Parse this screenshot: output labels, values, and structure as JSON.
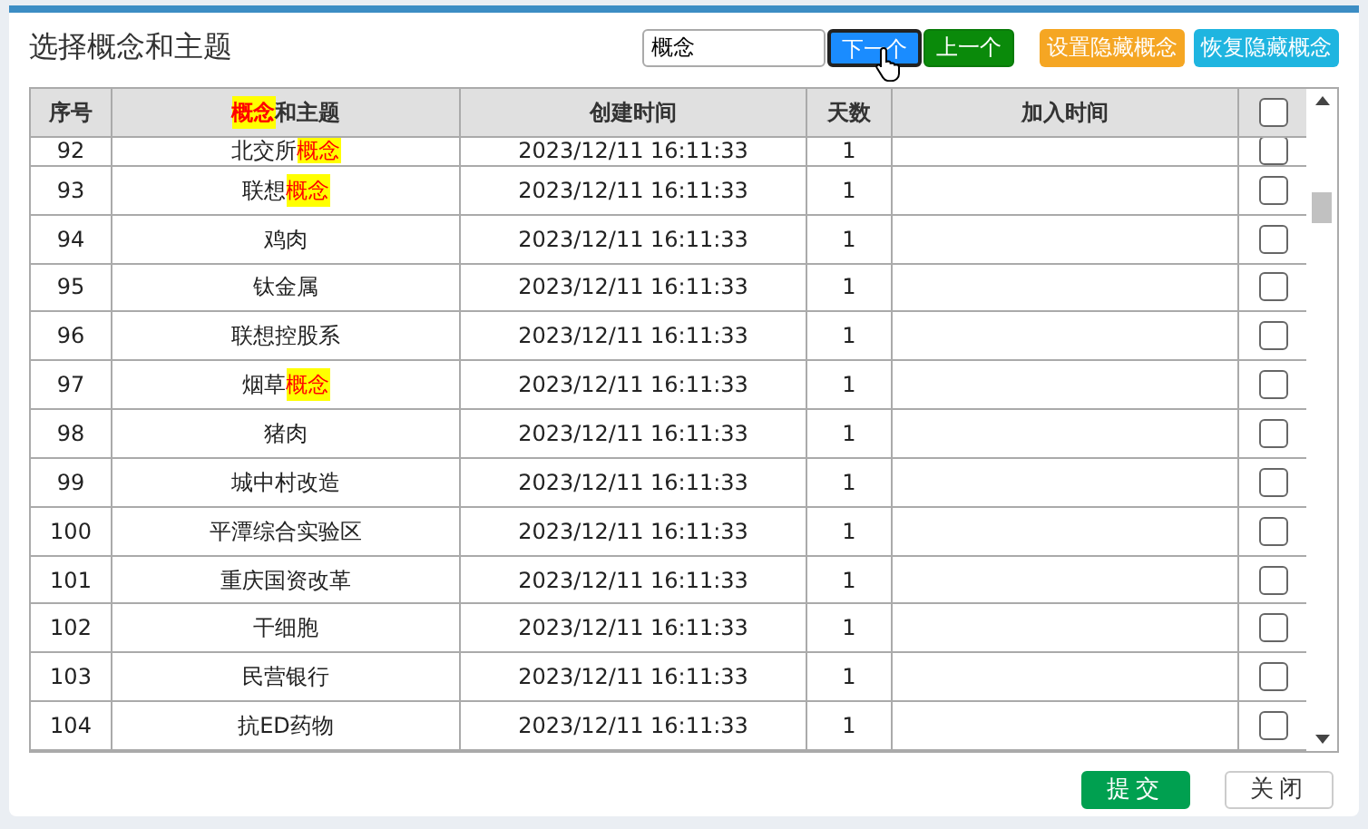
{
  "title": "选择概念和主题",
  "search": {
    "value": "概念"
  },
  "nav_buttons": [
    {
      "label": "下一个",
      "kind": "next"
    },
    {
      "label": "上一个",
      "kind": "prev"
    }
  ],
  "action_buttons": [
    {
      "label": "设置隐藏概念",
      "kind": "hide"
    },
    {
      "label": "恢复隐藏概念",
      "kind": "restore"
    }
  ],
  "table": {
    "columns": [
      {
        "parts": [
          {
            "text": "序号",
            "highlight": false
          }
        ]
      },
      {
        "parts": [
          {
            "text": "概念",
            "highlight": true
          },
          {
            "text": "和主题",
            "highlight": false
          }
        ]
      },
      {
        "parts": [
          {
            "text": "创建时间",
            "highlight": false
          }
        ]
      },
      {
        "parts": [
          {
            "text": "天数",
            "highlight": false
          }
        ]
      },
      {
        "parts": [
          {
            "text": "加入时间",
            "highlight": false
          }
        ]
      }
    ],
    "header_checked": false,
    "rows": [
      {
        "no": "92",
        "name": [
          {
            "text": "北交所",
            "highlight": false
          },
          {
            "text": "概念",
            "highlight": true
          }
        ],
        "created": "2023/12/11 16:11:33",
        "days": "1",
        "checked": false
      },
      {
        "no": "93",
        "name": [
          {
            "text": "联想",
            "highlight": false
          },
          {
            "text": "概念",
            "highlight": true
          }
        ],
        "created": "2023/12/11 16:11:33",
        "days": "1",
        "checked": false
      },
      {
        "no": "94",
        "name": [
          {
            "text": "鸡肉",
            "highlight": false
          }
        ],
        "created": "2023/12/11 16:11:33",
        "days": "1",
        "checked": false
      },
      {
        "no": "95",
        "name": [
          {
            "text": "钛金属",
            "highlight": false
          }
        ],
        "created": "2023/12/11 16:11:33",
        "days": "1",
        "checked": false
      },
      {
        "no": "96",
        "name": [
          {
            "text": "联想控股系",
            "highlight": false
          }
        ],
        "created": "2023/12/11 16:11:33",
        "days": "1",
        "checked": false
      },
      {
        "no": "97",
        "name": [
          {
            "text": "烟草",
            "highlight": false
          },
          {
            "text": "概念",
            "highlight": true
          }
        ],
        "created": "2023/12/11 16:11:33",
        "days": "1",
        "checked": false
      },
      {
        "no": "98",
        "name": [
          {
            "text": "猪肉",
            "highlight": false
          }
        ],
        "created": "2023/12/11 16:11:33",
        "days": "1",
        "checked": false
      },
      {
        "no": "99",
        "name": [
          {
            "text": "城中村改造",
            "highlight": false
          }
        ],
        "created": "2023/12/11 16:11:33",
        "days": "1",
        "checked": false
      },
      {
        "no": "100",
        "name": [
          {
            "text": "平潭综合实验区",
            "highlight": false
          }
        ],
        "created": "2023/12/11 16:11:33",
        "days": "1",
        "checked": false
      },
      {
        "no": "101",
        "name": [
          {
            "text": "重庆国资改革",
            "highlight": false
          }
        ],
        "created": "2023/12/11 16:11:33",
        "days": "1",
        "checked": false
      },
      {
        "no": "102",
        "name": [
          {
            "text": "干细胞",
            "highlight": false
          }
        ],
        "created": "2023/12/11 16:11:33",
        "days": "1",
        "checked": false
      },
      {
        "no": "103",
        "name": [
          {
            "text": "民营银行",
            "highlight": false
          }
        ],
        "created": "2023/12/11 16:11:33",
        "days": "1",
        "checked": false
      },
      {
        "no": "104",
        "name": [
          {
            "text": "抗ED药物",
            "highlight": false
          }
        ],
        "created": "2023/12/11 16:11:33",
        "days": "1",
        "checked": false
      }
    ]
  },
  "footer_buttons": [
    {
      "label": "提交",
      "kind": "primary"
    },
    {
      "label": "关闭",
      "kind": "secondary"
    }
  ]
}
